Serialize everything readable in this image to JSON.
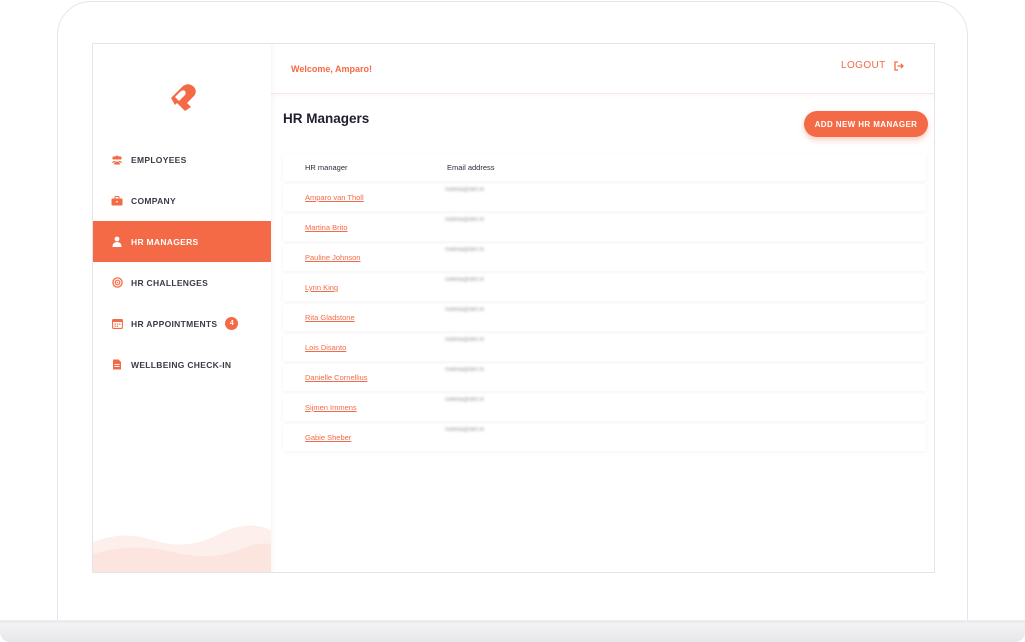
{
  "colors": {
    "accent": "#f46a46",
    "text_dark": "#1f1f2e",
    "sidebar_text": "#3b3b48"
  },
  "header": {
    "welcome": "Welcome, Amparo!",
    "logout_label": "LOGOUT",
    "logout_icon": "logout-icon"
  },
  "sidebar": {
    "logo_icon": "app-logo",
    "items": [
      {
        "label": "EMPLOYEES",
        "icon": "users-icon"
      },
      {
        "label": "COMPANY",
        "icon": "briefcase-icon"
      },
      {
        "label": "HR MANAGERS",
        "icon": "user-icon",
        "active": true
      },
      {
        "label": "HR CHALLENGES",
        "icon": "target-icon"
      },
      {
        "label": "HR APPOINTMENTS",
        "icon": "calendar-icon",
        "badge": "4"
      },
      {
        "label": "WELLBEING CHECK-IN",
        "icon": "document-icon"
      }
    ]
  },
  "main": {
    "title": "HR Managers",
    "add_button_label": "ADD NEW HR MANAGER",
    "table": {
      "headers": [
        "HR manager",
        "Email address"
      ],
      "rows": [
        {
          "name": "Amparo van Tholl",
          "email": "roelina@dirt.nl"
        },
        {
          "name": "Martina Brito",
          "email": "roelina@dirt.nl"
        },
        {
          "name": "Pauline Johnson",
          "email": "roelina@dirt.nl"
        },
        {
          "name": "Lynn King",
          "email": "roelina@dirt.nl"
        },
        {
          "name": "Rita Gladstone",
          "email": "roelina@dirt.nl"
        },
        {
          "name": "Lois Disanto",
          "email": "roelina@dirt.nl"
        },
        {
          "name": "Danielle Cornellius",
          "email": "roelina@dirt.nl"
        },
        {
          "name": "Sijmen Immens",
          "email": "roelina@dirt.nl"
        },
        {
          "name": "Gabie Sheber",
          "email": "roelina@dirt.nl"
        }
      ]
    }
  }
}
